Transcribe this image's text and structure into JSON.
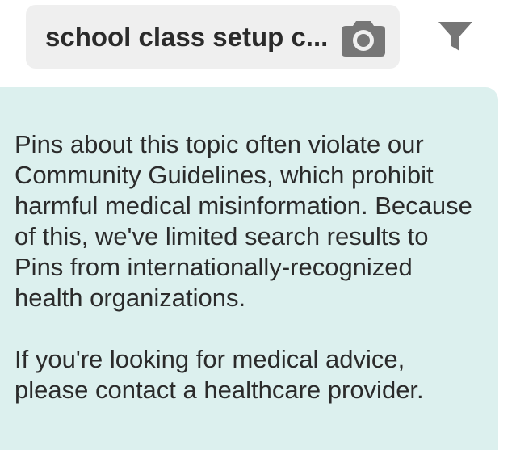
{
  "search": {
    "query": "school class setup c...",
    "camera_icon": "camera-icon"
  },
  "filter": {
    "icon": "filter-icon"
  },
  "notice": {
    "paragraph_1": "Pins about this topic often violate our Community Guidelines, which prohibit harmful medical misinformation. Because of this, we've limited search results to Pins from internationally-recognized health organizations.",
    "paragraph_2": "If you're looking for medical advice, please contact a healthcare provider."
  },
  "colors": {
    "search_bg": "#efefef",
    "notice_bg": "#dcf0ee",
    "icon_gray": "#767676",
    "text": "#2b2b2b"
  }
}
